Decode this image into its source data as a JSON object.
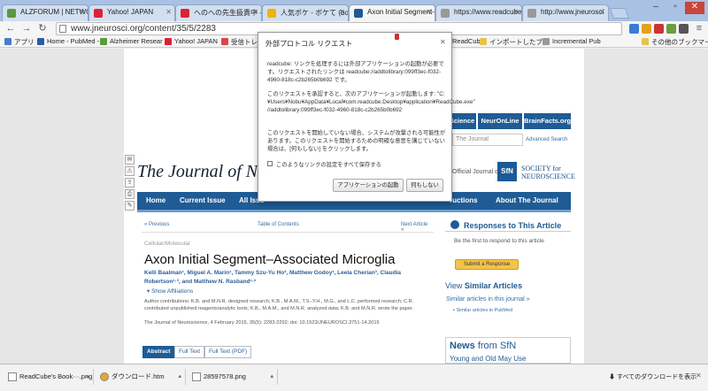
{
  "tabs": [
    {
      "label": "ALZFORUM | NETWOR",
      "color": "#5b9a3e"
    },
    {
      "label": "Yahoo! JAPAN",
      "color": "#d23"
    },
    {
      "label": "へのへの先生扱責中 -",
      "color": "#d23"
    },
    {
      "label": "人気ボケ - ボケて (bok",
      "color": "#f0b400"
    },
    {
      "label": "Axon Initial Segment–",
      "color": "#1f5b95"
    },
    {
      "label": "https://www.readcube",
      "color": "#999"
    },
    {
      "label": "http://www.jneurosci",
      "color": "#999"
    }
  ],
  "address": {
    "url": "www.jneurosci.org/content/35/5/2283"
  },
  "bookmarks": {
    "items": [
      {
        "label": "アプリ",
        "color": "#4a7bd0"
      },
      {
        "label": "Home - PubMed -",
        "color": "#2a5da8"
      },
      {
        "label": "Alzheimer Resear",
        "color": "#5b9a3e"
      },
      {
        "label": "Yahoo! JAPAN",
        "color": "#d23"
      },
      {
        "label": "受信トレイ",
        "color": "#d44"
      },
      {
        "label": "ReadCube",
        "color": "#c33"
      },
      {
        "label": "インポートしたブ",
        "color": "#e6c34a"
      },
      {
        "label": "Incremental Pub",
        "color": "#999"
      }
    ],
    "other": "その他のブックマーク"
  },
  "journal": {
    "title": "The Journal of Neuroscience",
    "official": "Official Journal of",
    "sfn_line1": "SOCIETY for",
    "sfn_line2": "NEUROSCIENCE",
    "sfn_logo": "SfN",
    "search_placeholder": "The Journal",
    "advanced": "Advanced Search",
    "top_links": [
      "Science",
      "NeurOnLine",
      "BrainFacts.org"
    ]
  },
  "navbar": {
    "items": [
      "Home",
      "Current Issue",
      "All Issu",
      "ructions",
      "About The Journal"
    ]
  },
  "article": {
    "prev": "« Previous",
    "toc": "Table of Contents",
    "next": "Next Article »",
    "category": "Cellular/Molecular",
    "title": "Axon Initial Segment–Associated Microglia",
    "authors": "Kelli Baalman¹, Miguel A. Marin¹, Tammy Szu-Yu Ho², Matthew Godoy¹, Leela Cherian³, Claudia Robertson¹·³, and Matthew N. Rasband¹·²",
    "affiliations": "▾ Show Affiliations",
    "contributions": "Author contributions: K.B. and M.N.R. designed research; K.B., M.A.M., T.S.-Y.H., M.G., and L.C. performed research; C.R. contributed unpublished reagents/analytic tools; K.B., M.A.M., and M.N.R. analyzed data; K.B. and M.N.R. wrote the paper.",
    "citation": "The Journal of Neuroscience, 4 February 2015, 35(5): 2283-2292; doi: 10.1523/JNEUROSCI.3751-14.2015",
    "formats": [
      "Abstract",
      "Full Text",
      "Full Text (PDF)"
    ]
  },
  "responses": {
    "title": "Responses to This Article",
    "note": "Be the first to respond to this article",
    "button": "Submit a Response"
  },
  "similar": {
    "prefix": "View",
    "title": "Similar Articles",
    "link1": "Similar articles in this journal »",
    "link2": "Similar articles in PubMed"
  },
  "news": {
    "prefix": "News",
    "title": "from SfN",
    "item": "Young and Old May Use"
  },
  "dialog": {
    "title": "外部プロトコル リクエスト",
    "p1": "readcube: リンクを処理するには外部アプリケーションの起動が必要です。リクエストされたリンクは readcube://addtolibrary:099ff3ec-f032-4960-818c-c2b265b0b692 です。",
    "p2": "このリクエストを承認すると、次のアプリケーションが起動します: \"C:¥Users¥Nobu¥AppData¥Local¥com.readcube.Desktop¥application¥ReadCube.exe\" //addtolibrary:099ff3ec-f032-4960-818c-c2b265b0b692",
    "p3": "このリクエストを開始していない場合、システムが攻撃される可能性があります。このリクエストを開始するための明確な意思を講じていない場合は、[何もしない] をクリックします。",
    "checkbox": "このようなリンクの設定をすべて保存する",
    "launch": "アプリケーションの起動",
    "nothing": "何もしない"
  },
  "downloads": {
    "items": [
      "ReadCube's Book···.png",
      "ダウンロード.htm",
      "28597578.png"
    ],
    "show_all": "すべてのダウンロードを表示"
  }
}
